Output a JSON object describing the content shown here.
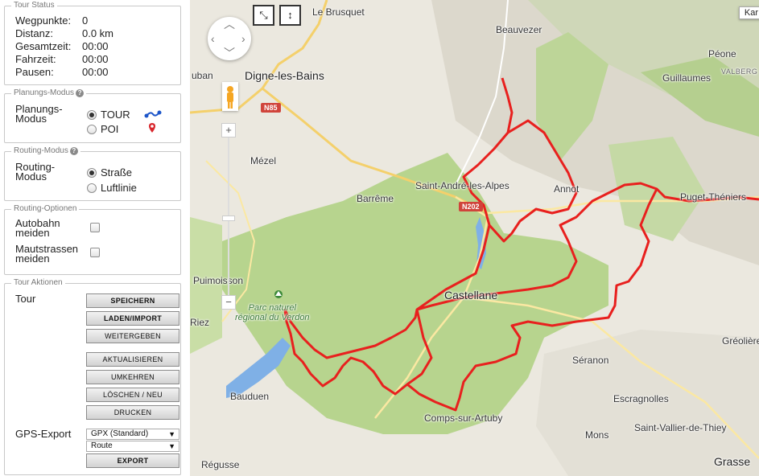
{
  "tour_status": {
    "legend": "Tour Status",
    "rows": [
      {
        "label": "Wegpunkte:",
        "value": "0"
      },
      {
        "label": "Distanz:",
        "value": "0.0 km"
      },
      {
        "label": "Gesamtzeit:",
        "value": "00:00"
      },
      {
        "label": "Fahrzeit:",
        "value": "00:00"
      },
      {
        "label": "Pausen:",
        "value": "00:00"
      }
    ]
  },
  "planning_mode": {
    "legend": "Planungs-Modus",
    "label_line1": "Planungs-",
    "label_line2": "Modus",
    "options": [
      {
        "label": "TOUR",
        "selected": true,
        "icon": "tour-route-icon"
      },
      {
        "label": "POI",
        "selected": false,
        "icon": "poi-marker-icon"
      }
    ]
  },
  "routing_mode": {
    "legend": "Routing-Modus",
    "label_line1": "Routing-",
    "label_line2": "Modus",
    "options": [
      {
        "label": "Straße",
        "selected": true
      },
      {
        "label": "Luftlinie",
        "selected": false
      }
    ]
  },
  "routing_options": {
    "legend": "Routing-Optionen",
    "options": [
      {
        "line1": "Autobahn",
        "line2": "meiden",
        "checked": false
      },
      {
        "line1": "Mautstrassen",
        "line2": "meiden",
        "checked": false
      }
    ]
  },
  "tour_actions": {
    "legend": "Tour Aktionen",
    "tour_label": "Tour",
    "buttons_group1": [
      "Speichern",
      "Laden/Import",
      "Weitergeben"
    ],
    "buttons_group2": [
      "Aktualisieren",
      "Umkehren",
      "Löschen / Neu",
      "Drucken"
    ],
    "gps_label": "GPS-Export",
    "gps_format": "GPX (Standard)",
    "gps_type": "Route",
    "export_button": "Export"
  },
  "map": {
    "zoom_in": "+",
    "zoom_out": "−",
    "map_type_button": "Kar",
    "places": [
      {
        "name": "Le Brusquet",
        "cls": ""
      },
      {
        "name": "Beauvezer",
        "cls": ""
      },
      {
        "name": "Péone",
        "cls": ""
      },
      {
        "name": "Guillaumes",
        "cls": ""
      },
      {
        "name": "VALBERG",
        "cls": "tiny"
      },
      {
        "name": "Digne-les-Bains",
        "cls": "big"
      },
      {
        "name": "uban",
        "cls": ""
      },
      {
        "name": "Mézel",
        "cls": ""
      },
      {
        "name": "Saint-André-les-Alpes",
        "cls": ""
      },
      {
        "name": "Annot",
        "cls": ""
      },
      {
        "name": "Puget-Théniers",
        "cls": ""
      },
      {
        "name": "Barrême",
        "cls": ""
      },
      {
        "name": "Puimoisson",
        "cls": ""
      },
      {
        "name": "Castellane",
        "cls": "big"
      },
      {
        "name": "Riez",
        "cls": ""
      },
      {
        "name": "Gréolières",
        "cls": ""
      },
      {
        "name": "Séranon",
        "cls": ""
      },
      {
        "name": "Bauduen",
        "cls": ""
      },
      {
        "name": "Escragnolles",
        "cls": ""
      },
      {
        "name": "Comps-sur-Artuby",
        "cls": ""
      },
      {
        "name": "Saint-Vallier-de-Thiey",
        "cls": ""
      },
      {
        "name": "Mons",
        "cls": ""
      },
      {
        "name": "Grasse",
        "cls": "big"
      },
      {
        "name": "Régusse",
        "cls": ""
      }
    ],
    "park_name_line1": "Parc naturel",
    "park_name_line2": "régional du Verdon",
    "road_labels": [
      "N85",
      "N202"
    ],
    "route_color": "#e8201e"
  }
}
